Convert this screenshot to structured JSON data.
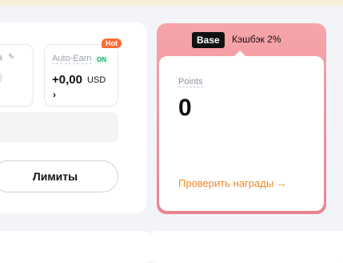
{
  "cashback_card": {
    "auto_earn_label": "Auto-Earn",
    "auto_earn_status": "ON",
    "hot_badge": "Hot",
    "amount": "+0,00",
    "currency": "USD",
    "chevron": "›",
    "left_label": "ra",
    "edit_icon": "pencil-icon",
    "limits_button": "Лимиты"
  },
  "reward_card": {
    "tier_badge": "Base",
    "cashback_text": "Кэшбэк 2%",
    "points_label": "Points",
    "points_value": "0",
    "check_rewards_link": "Проверить награды →",
    "accent_color": "#f0882a"
  }
}
